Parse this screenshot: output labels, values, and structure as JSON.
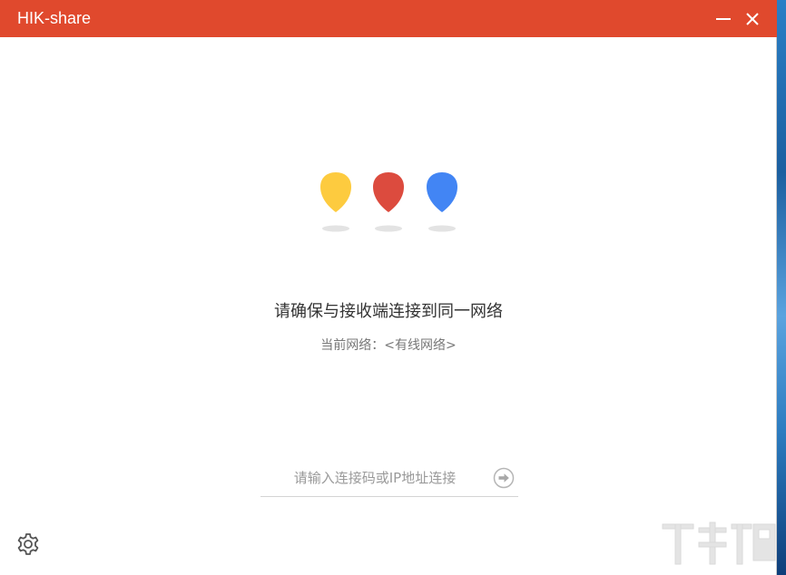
{
  "window": {
    "title": "HIK-share"
  },
  "colors": {
    "titlebar": "#e0492d",
    "pin_yellow": "#fdcb3f",
    "pin_red": "#dc4b3e",
    "pin_blue": "#4285f4"
  },
  "main": {
    "message": "请确保与接收端连接到同一网络",
    "network_label": "当前网络：",
    "network_value": "<有线网络>"
  },
  "connect": {
    "placeholder": "请输入连接码或IP地址连接",
    "value": ""
  },
  "icons": {
    "minimize": "minimize-icon",
    "close": "close-icon",
    "go": "arrow-right-circle-icon",
    "settings": "gear-icon"
  }
}
